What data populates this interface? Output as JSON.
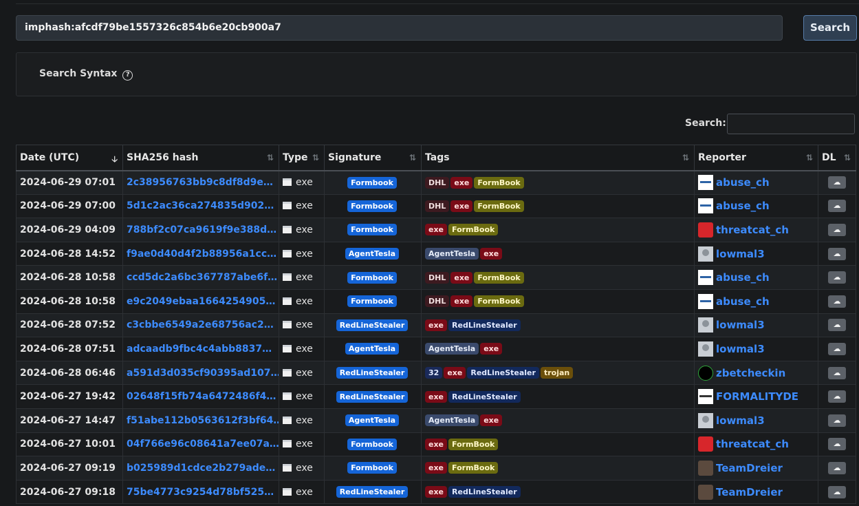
{
  "search": {
    "query": "imphash:afcdf79be1557326c854b6e20cb900a7",
    "button": "Search"
  },
  "syntax": {
    "label": "Search Syntax",
    "help_icon": "question-circle-icon"
  },
  "filter": {
    "label": "Search:",
    "value": ""
  },
  "table": {
    "headers": [
      "Date (UTC)",
      "SHA256 hash",
      "Type",
      "Signature",
      "Tags",
      "Reporter",
      "DL"
    ],
    "rows": [
      {
        "date": "2024-06-29 07:01",
        "hash": "2c38956763bb9c8df8d9e…",
        "type": "exe",
        "signature": "Formbook",
        "tags": [
          "DHL",
          "exe",
          "FormBook"
        ],
        "reporter": "abuse_ch"
      },
      {
        "date": "2024-06-29 07:00",
        "hash": "5d1c2ac36ca274835d902…",
        "type": "exe",
        "signature": "Formbook",
        "tags": [
          "DHL",
          "exe",
          "FormBook"
        ],
        "reporter": "abuse_ch"
      },
      {
        "date": "2024-06-29 04:09",
        "hash": "788bf2c07ca9619f9e388d…",
        "type": "exe",
        "signature": "Formbook",
        "tags": [
          "exe",
          "FormBook"
        ],
        "reporter": "threatcat_ch"
      },
      {
        "date": "2024-06-28 14:52",
        "hash": "f9ae0d40d4f2b88956a1cc…",
        "type": "exe",
        "signature": "AgentTesla",
        "tags": [
          "AgentTesla",
          "exe"
        ],
        "reporter": "lowmal3"
      },
      {
        "date": "2024-06-28 10:58",
        "hash": "ccd5dc2a6bc367787abe6f…",
        "type": "exe",
        "signature": "Formbook",
        "tags": [
          "DHL",
          "exe",
          "FormBook"
        ],
        "reporter": "abuse_ch"
      },
      {
        "date": "2024-06-28 10:58",
        "hash": "e9c2049ebaa1664254905…",
        "type": "exe",
        "signature": "Formbook",
        "tags": [
          "DHL",
          "exe",
          "FormBook"
        ],
        "reporter": "abuse_ch"
      },
      {
        "date": "2024-06-28 07:52",
        "hash": "c3cbbe6549a2e68756ac2…",
        "type": "exe",
        "signature": "RedLineStealer",
        "tags": [
          "exe",
          "RedLineStealer"
        ],
        "reporter": "lowmal3"
      },
      {
        "date": "2024-06-28 07:51",
        "hash": "adcaadb9fbc4c4abb8837…",
        "type": "exe",
        "signature": "AgentTesla",
        "tags": [
          "AgentTesla",
          "exe"
        ],
        "reporter": "lowmal3"
      },
      {
        "date": "2024-06-28 06:46",
        "hash": "a591d3d035cf90395ad107…",
        "type": "exe",
        "signature": "RedLineStealer",
        "tags": [
          "32",
          "exe",
          "RedLineStealer",
          "trojan"
        ],
        "reporter": "zbetcheckin"
      },
      {
        "date": "2024-06-27 19:42",
        "hash": "02648f15fb74a6472486f4…",
        "type": "exe",
        "signature": "RedLineStealer",
        "tags": [
          "exe",
          "RedLineStealer"
        ],
        "reporter": "FORMALITYDE"
      },
      {
        "date": "2024-06-27 14:47",
        "hash": "f51abe112b0563612f3bf64…",
        "type": "exe",
        "signature": "AgentTesla",
        "tags": [
          "AgentTesla",
          "exe"
        ],
        "reporter": "lowmal3"
      },
      {
        "date": "2024-06-27 10:01",
        "hash": "04f766e96c08641a7ee07a…",
        "type": "exe",
        "signature": "Formbook",
        "tags": [
          "exe",
          "FormBook"
        ],
        "reporter": "threatcat_ch"
      },
      {
        "date": "2024-06-27 09:19",
        "hash": "b025989d1cdce2b279ade…",
        "type": "exe",
        "signature": "Formbook",
        "tags": [
          "exe",
          "FormBook"
        ],
        "reporter": "TeamDreier"
      },
      {
        "date": "2024-06-27 09:18",
        "hash": "75be4773c9254d78bf525…",
        "type": "exe",
        "signature": "RedLineStealer",
        "tags": [
          "exe",
          "RedLineStealer"
        ],
        "reporter": "TeamDreier"
      }
    ]
  }
}
